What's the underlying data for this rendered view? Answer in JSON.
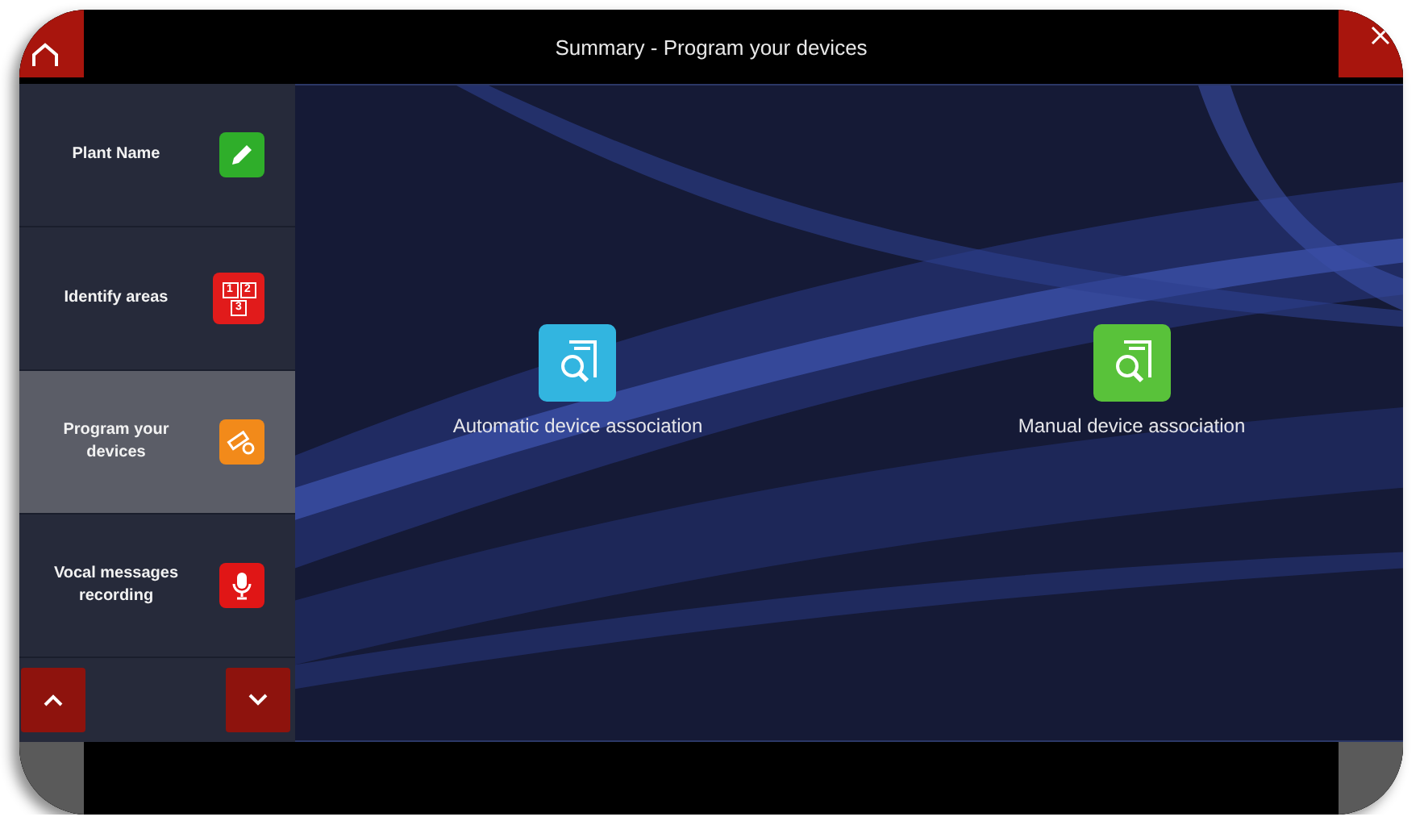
{
  "title": "Summary - Program your devices",
  "steps": [
    {
      "label": "Plant Name",
      "kind": "edit",
      "selected": false
    },
    {
      "label": "Identify areas",
      "kind": "areas",
      "selected": false,
      "icon_text": [
        "1",
        "2",
        "3"
      ]
    },
    {
      "label": "Program your devices",
      "kind": "program",
      "selected": true
    },
    {
      "label": "Vocal messages recording",
      "kind": "record",
      "selected": false
    }
  ],
  "actions": [
    {
      "label": "Automatic device association",
      "kind": "auto"
    },
    {
      "label": "Manual device association",
      "kind": "manual"
    }
  ]
}
